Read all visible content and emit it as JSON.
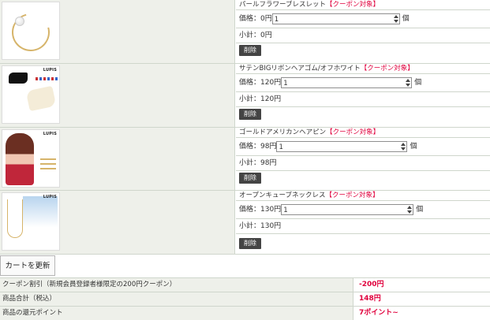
{
  "items": [
    {
      "name": "パールフラワーブレスレット",
      "coupon": "【クーポン対象】",
      "price_label": "価格：0円",
      "qty": "1",
      "unit": "個",
      "subtotal": "小計：0円",
      "delete": "削除",
      "brand": ""
    },
    {
      "name": "サテンBIGリボンヘアゴム/オフホワイト",
      "coupon": "【クーポン対象】",
      "price_label": "価格：120円",
      "qty": "1",
      "unit": "個",
      "subtotal": "小計：120円",
      "delete": "削除",
      "brand": "LUPIS"
    },
    {
      "name": "ゴールドアメリカンヘアピン",
      "coupon": "【クーポン対象】",
      "price_label": "価格：98円",
      "qty": "1",
      "unit": "個",
      "subtotal": "小計：98円",
      "delete": "削除",
      "brand": "LUPIS"
    },
    {
      "name": "オープンキューブネックレス",
      "coupon": "【クーポン対象】",
      "price_label": "価格：130円",
      "qty": "1",
      "unit": "個",
      "subtotal": "小計：130円",
      "delete": "削除",
      "brand": "LUPIS"
    }
  ],
  "update_button": "カートを更新",
  "summary": [
    {
      "label": "クーポン割引（新規会員登録者様限定の200円クーポン）",
      "value": "-200円"
    },
    {
      "label": "商品合計（税込）",
      "value": "148円"
    },
    {
      "label": "商品の還元ポイント",
      "value": "7ポイント~"
    }
  ]
}
